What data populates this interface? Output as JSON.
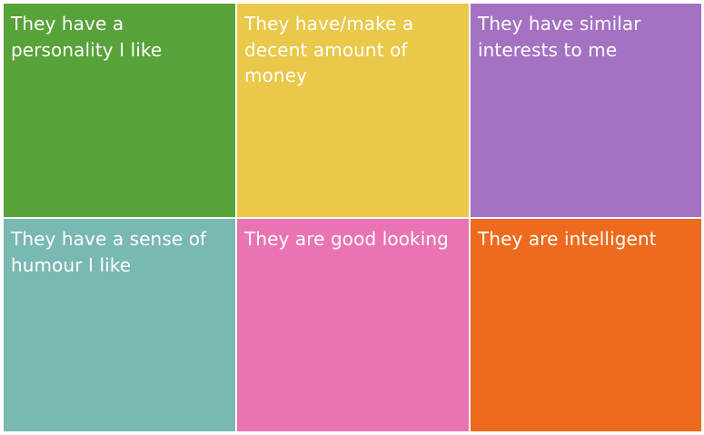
{
  "chart_data": {
    "type": "treemap",
    "title": "",
    "grid": false,
    "legend": "none",
    "categories": [
      "They have a personality I like",
      "They have/make a decent amount of money",
      "They have similar interests to me",
      "They have a sense of humour I like",
      "They are good looking",
      "They are intelligent"
    ],
    "values": [
      1,
      1,
      1,
      1,
      1,
      1
    ],
    "colors": [
      "#58a23a",
      "#e9c84a",
      "#a571c3",
      "#7ab8b2",
      "#ea74b3",
      "#ee6a1c"
    ],
    "rows": 2,
    "columns": 3
  }
}
